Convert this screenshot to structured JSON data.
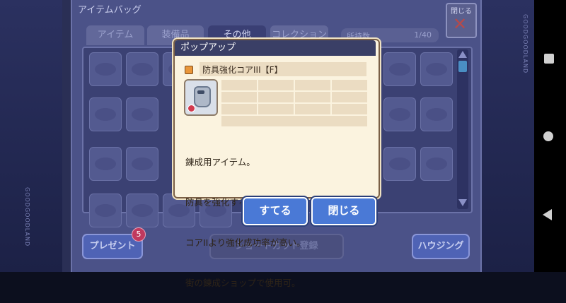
{
  "bag": {
    "title": "アイテムバッグ",
    "close_label": "閉じる",
    "tabs": [
      {
        "label": "アイテム",
        "active": false
      },
      {
        "label": "装備品",
        "active": false
      },
      {
        "label": "その他",
        "active": true
      },
      {
        "label": "コレクション",
        "active": false
      }
    ],
    "counter_label": "所持数",
    "counter_value": "1/40",
    "side_left_text": "GOODGOODLAND",
    "side_right_text": "GOODGOODLAND",
    "bottom_buttons": {
      "present": "プレゼント",
      "present_badge": "5",
      "shortcut": "ショートカット登録",
      "housing": "ハウジング"
    }
  },
  "popup": {
    "header": "ポップアップ",
    "item_name": "防具強化コアIII【F】",
    "item_icon": "armor-core-icon",
    "description": [
      "錬成用アイテム。",
      "防具を強化するために必要。",
      "コアIIより強化成功率が高い。",
      "街の錬成ショップで使用可。"
    ],
    "discard_label": "すてる",
    "close_label": "閉じる"
  },
  "colors": {
    "popup_bg": "#fbf3df",
    "popup_header": "#3a3f66",
    "button_blue": "#4a79d6",
    "badge_red": "#c0395e"
  }
}
